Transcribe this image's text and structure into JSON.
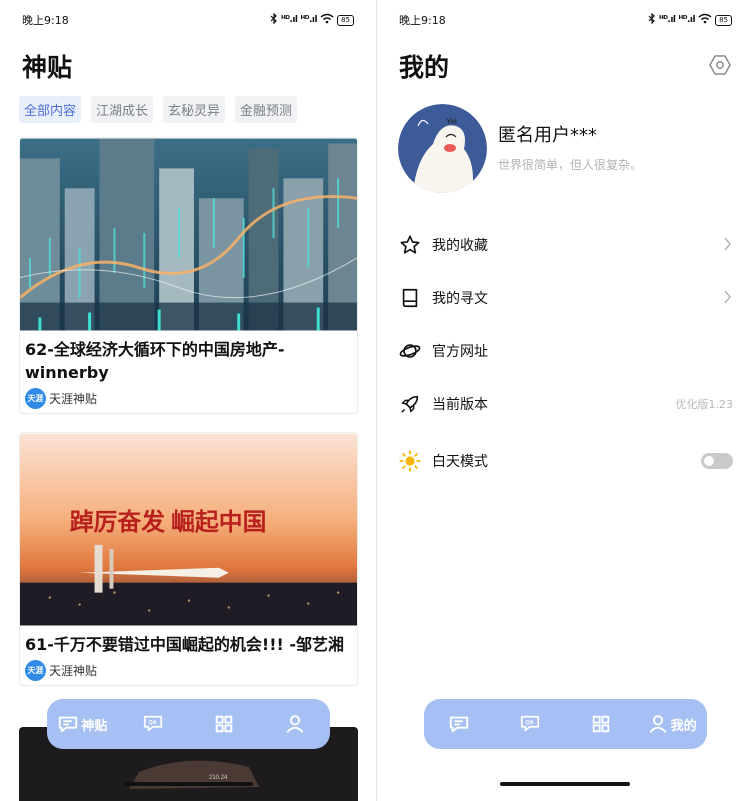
{
  "status_bar": {
    "time": "晚上9:18",
    "signal_1": "ᴴᴰ.ıl",
    "signal_2": "ᴴᴰ.ıl",
    "battery": "85"
  },
  "feed": {
    "title": "神贴",
    "tabs": [
      "全部内容",
      "江湖成长",
      "玄秘灵异",
      "金融预测"
    ],
    "active_tab": 0,
    "posts": [
      {
        "title": "62-全球经济大循环下的中国房地产-winnerby",
        "source": "天涯神贴",
        "source_logo": "天涯",
        "image": "city-stock-chart"
      },
      {
        "title": "61-千万不要错过中国崛起的机会!!! -邹艺湘",
        "source": "天涯神贴",
        "source_logo": "天涯",
        "image_text": "踔厉奋发  崛起中国"
      }
    ],
    "third_card_label": "210.24"
  },
  "profile": {
    "title": "我的",
    "username": "匿名用户***",
    "bio": "世界很简单，但人很复杂。",
    "avatar_text": "Yei",
    "menu": [
      {
        "icon": "star-icon",
        "label": "我的收藏",
        "chevron": true
      },
      {
        "icon": "book-icon",
        "label": "我的寻文",
        "chevron": true
      },
      {
        "icon": "planet-icon",
        "label": "官方网址",
        "chevron": false
      },
      {
        "icon": "rocket-icon",
        "label": "当前版本",
        "value": "优化版1.23"
      },
      {
        "icon": "sun-icon",
        "label": "白天模式",
        "toggle": false
      }
    ]
  },
  "nav": {
    "home_label": "神贴",
    "profile_label": "我的"
  },
  "colors": {
    "accent": "#4a6fd8",
    "navbar": "#a7c0f4",
    "sun": "#f5b400"
  }
}
